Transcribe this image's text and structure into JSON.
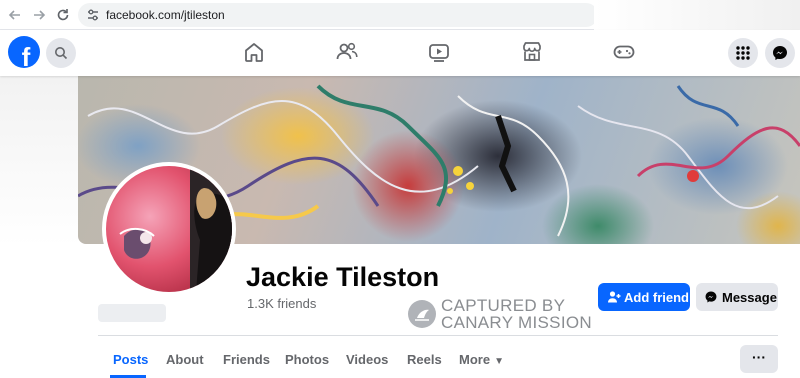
{
  "browser": {
    "url": "facebook.com/jtileston"
  },
  "header": {
    "logo_letter": "f",
    "nav_icons": [
      "home-icon",
      "friends-icon",
      "watch-icon",
      "marketplace-icon",
      "gaming-icon"
    ],
    "right_icons": [
      "menu-grid-icon",
      "messenger-icon"
    ]
  },
  "profile": {
    "name": "Jackie Tileston",
    "friends": "1.3K friends",
    "add_friend_label": "Add friend",
    "message_label": "Message"
  },
  "watermark": {
    "line1": "CAPTURED BY",
    "line2": "CANARY MISSION"
  },
  "tabs": [
    {
      "label": "Posts",
      "active": true
    },
    {
      "label": "About"
    },
    {
      "label": "Friends"
    },
    {
      "label": "Photos"
    },
    {
      "label": "Videos"
    },
    {
      "label": "Reels"
    },
    {
      "label": "More"
    }
  ],
  "more_button": "···",
  "colors": {
    "brand": "#0866ff",
    "secondary_button": "#e4e6eb",
    "muted_text": "#65676b"
  }
}
